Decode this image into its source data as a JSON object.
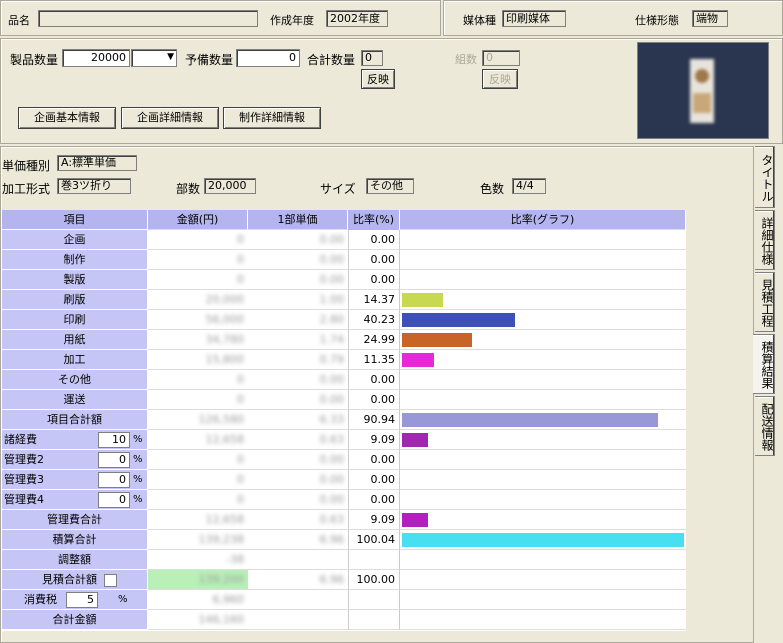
{
  "header": {
    "product_name_label": "品名",
    "product_name_value": "",
    "created_year_label": "作成年度",
    "created_year_value": "2002年度",
    "media_type_label": "媒体種",
    "media_type_value": "印刷媒体",
    "spec_form_label": "仕様形態",
    "spec_form_value": "端物"
  },
  "quantities": {
    "product_qty_label": "製品数量",
    "product_qty_value": "20000",
    "spare_qty_label": "予備数量",
    "spare_qty_value": "0",
    "total_qty_label": "合計数量",
    "total_qty_value": "0",
    "apply_label": "反映",
    "sets_label": "組数",
    "sets_value": "0",
    "apply2_label": "反映"
  },
  "buttons": {
    "plan_basic": "企画基本情報",
    "plan_detail": "企画詳細情報",
    "production_detail": "制作詳細情報"
  },
  "info": {
    "unit_price_type_label": "単価種別",
    "unit_price_type_value": "A:標準単価",
    "processing_label": "加工形式",
    "processing_value": "巻3ツ折り",
    "copies_label": "部数",
    "copies_value": "20,000",
    "size_label": "サイズ",
    "size_value": "その他",
    "colors_label": "色数",
    "colors_value": "4/4"
  },
  "table": {
    "headers": [
      "項目",
      "金額(円)",
      "1部単価",
      "比率(%)",
      "比率(グラフ)"
    ],
    "rows": [
      {
        "item": "企画",
        "amount": "0",
        "unit": "0.00",
        "ratio": "0.00",
        "bar": 0,
        "color": ""
      },
      {
        "item": "制作",
        "amount": "0",
        "unit": "0.00",
        "ratio": "0.00",
        "bar": 0,
        "color": ""
      },
      {
        "item": "製版",
        "amount": "0",
        "unit": "0.00",
        "ratio": "0.00",
        "bar": 0,
        "color": ""
      },
      {
        "item": "刷版",
        "amount": "20,000",
        "unit": "1.00",
        "ratio": "14.37",
        "bar": 14.37,
        "color": "#c8d850"
      },
      {
        "item": "印刷",
        "amount": "56,000",
        "unit": "2.80",
        "ratio": "40.23",
        "bar": 40.23,
        "color": "#3c50b8"
      },
      {
        "item": "用紙",
        "amount": "34,780",
        "unit": "1.74",
        "ratio": "24.99",
        "bar": 24.99,
        "color": "#c86428"
      },
      {
        "item": "加工",
        "amount": "15,800",
        "unit": "0.79",
        "ratio": "11.35",
        "bar": 11.35,
        "color": "#e628d8"
      },
      {
        "item": "その他",
        "amount": "0",
        "unit": "0.00",
        "ratio": "0.00",
        "bar": 0,
        "color": ""
      },
      {
        "item": "運送",
        "amount": "0",
        "unit": "0.00",
        "ratio": "0.00",
        "bar": 0,
        "color": ""
      },
      {
        "item": "項目合計額",
        "amount": "126,580",
        "unit": "6.33",
        "ratio": "90.94",
        "bar": 90.94,
        "color": "#9898d8"
      },
      {
        "item": "諸経費",
        "pct": "10",
        "amount": "12,658",
        "unit": "0.63",
        "ratio": "9.09",
        "bar": 9.09,
        "color": "#a028b0"
      },
      {
        "item": "管理費2",
        "pct": "0",
        "amount": "0",
        "unit": "0.00",
        "ratio": "0.00",
        "bar": 0,
        "color": ""
      },
      {
        "item": "管理費3",
        "pct": "0",
        "amount": "0",
        "unit": "0.00",
        "ratio": "0.00",
        "bar": 0,
        "color": ""
      },
      {
        "item": "管理費4",
        "pct": "0",
        "amount": "0",
        "unit": "0.00",
        "ratio": "0.00",
        "bar": 0,
        "color": ""
      },
      {
        "item": "管理費合計",
        "amount": "12,658",
        "unit": "0.63",
        "ratio": "9.09",
        "bar": 9.09,
        "color": "#b420c0"
      },
      {
        "item": "積算合計",
        "amount": "139,238",
        "unit": "6.96",
        "ratio": "100.04",
        "bar": 100.04,
        "color": "#48e0f0"
      },
      {
        "item": "調整額",
        "amount": "-38",
        "unit": "",
        "ratio": "",
        "bar": 0,
        "color": ""
      },
      {
        "item": "見積合計額",
        "amount": "139,200",
        "unit": "6.96",
        "ratio": "100.00",
        "bar": 0,
        "color": "",
        "highlight": "#b8f0b8"
      },
      {
        "item": "消費税",
        "pct": "5",
        "amount": "6,960",
        "unit": "",
        "ratio": "",
        "bar": 0,
        "color": ""
      },
      {
        "item": "合計金額",
        "amount": "146,160",
        "unit": "",
        "ratio": "",
        "bar": 0,
        "color": ""
      }
    ]
  },
  "tabs": [
    {
      "label": "タイトル"
    },
    {
      "label": "詳細仕様"
    },
    {
      "label": "見積工程"
    },
    {
      "label": "積算結果"
    },
    {
      "label": "配送情報"
    }
  ]
}
